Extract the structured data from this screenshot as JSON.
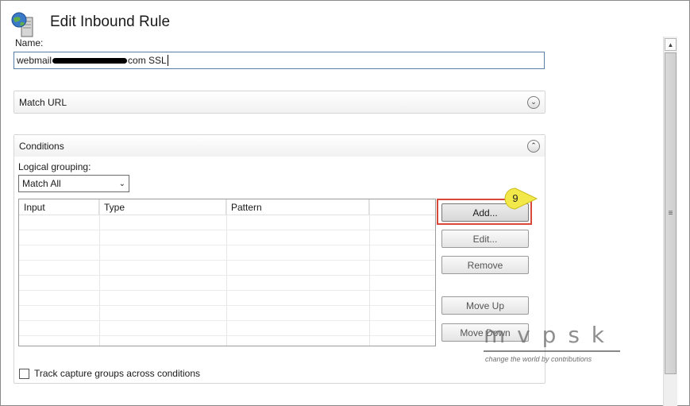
{
  "header": {
    "title": "Edit Inbound Rule",
    "icon": "iis-server-globe-icon"
  },
  "name": {
    "label": "Name:",
    "value_prefix": "webmail",
    "value_suffix": "com SSL"
  },
  "match_url": {
    "title": "Match URL",
    "toggle_glyph": "⌄"
  },
  "conditions": {
    "title": "Conditions",
    "toggle_glyph": "⌃",
    "logical_grouping_label": "Logical grouping:",
    "logical_grouping_value": "Match All",
    "columns": [
      "Input",
      "Type",
      "Pattern",
      ""
    ],
    "buttons": {
      "add": "Add...",
      "edit": "Edit...",
      "remove": "Remove",
      "move_up": "Move Up",
      "move_down": "Move Down"
    },
    "track_capture_label": "Track capture groups across conditions"
  },
  "callout": {
    "number": "9",
    "color": "#f2e84a"
  },
  "highlight_color": "#d9493a",
  "watermark": {
    "text": "m   v p s k",
    "tagline": "change the world by contributions"
  }
}
